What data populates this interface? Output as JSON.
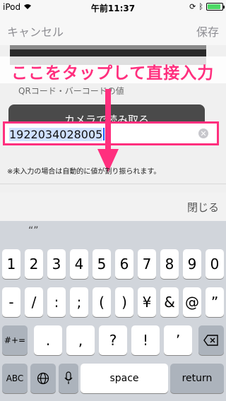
{
  "status": {
    "carrier": "iPod",
    "time": "午前11:37",
    "battery_level": 0.9
  },
  "nav": {
    "cancel": "キャンセル",
    "save": "保存"
  },
  "annotation": {
    "text": "ここをタップして直接入力",
    "color": "#ff2f7e"
  },
  "form": {
    "qr_label": "QRコード・バーコードの値",
    "read_button": "カメラで読み取る",
    "input_value": "1922034028005",
    "note": "※未入力の場合は自動的に値が割り振られます。"
  },
  "close_label": "閉じる",
  "keyboard": {
    "predictive": "“”",
    "row1": [
      "1",
      "2",
      "3",
      "4",
      "5",
      "6",
      "7",
      "8",
      "9",
      "0"
    ],
    "row2": [
      "-",
      "/",
      ":",
      ";",
      "(",
      ")",
      "¥",
      "&",
      "@",
      "”"
    ],
    "row3": [
      "#+=",
      ".",
      ",",
      "?",
      "!",
      "’"
    ],
    "row4": [
      "ABC",
      "space",
      "return"
    ]
  }
}
